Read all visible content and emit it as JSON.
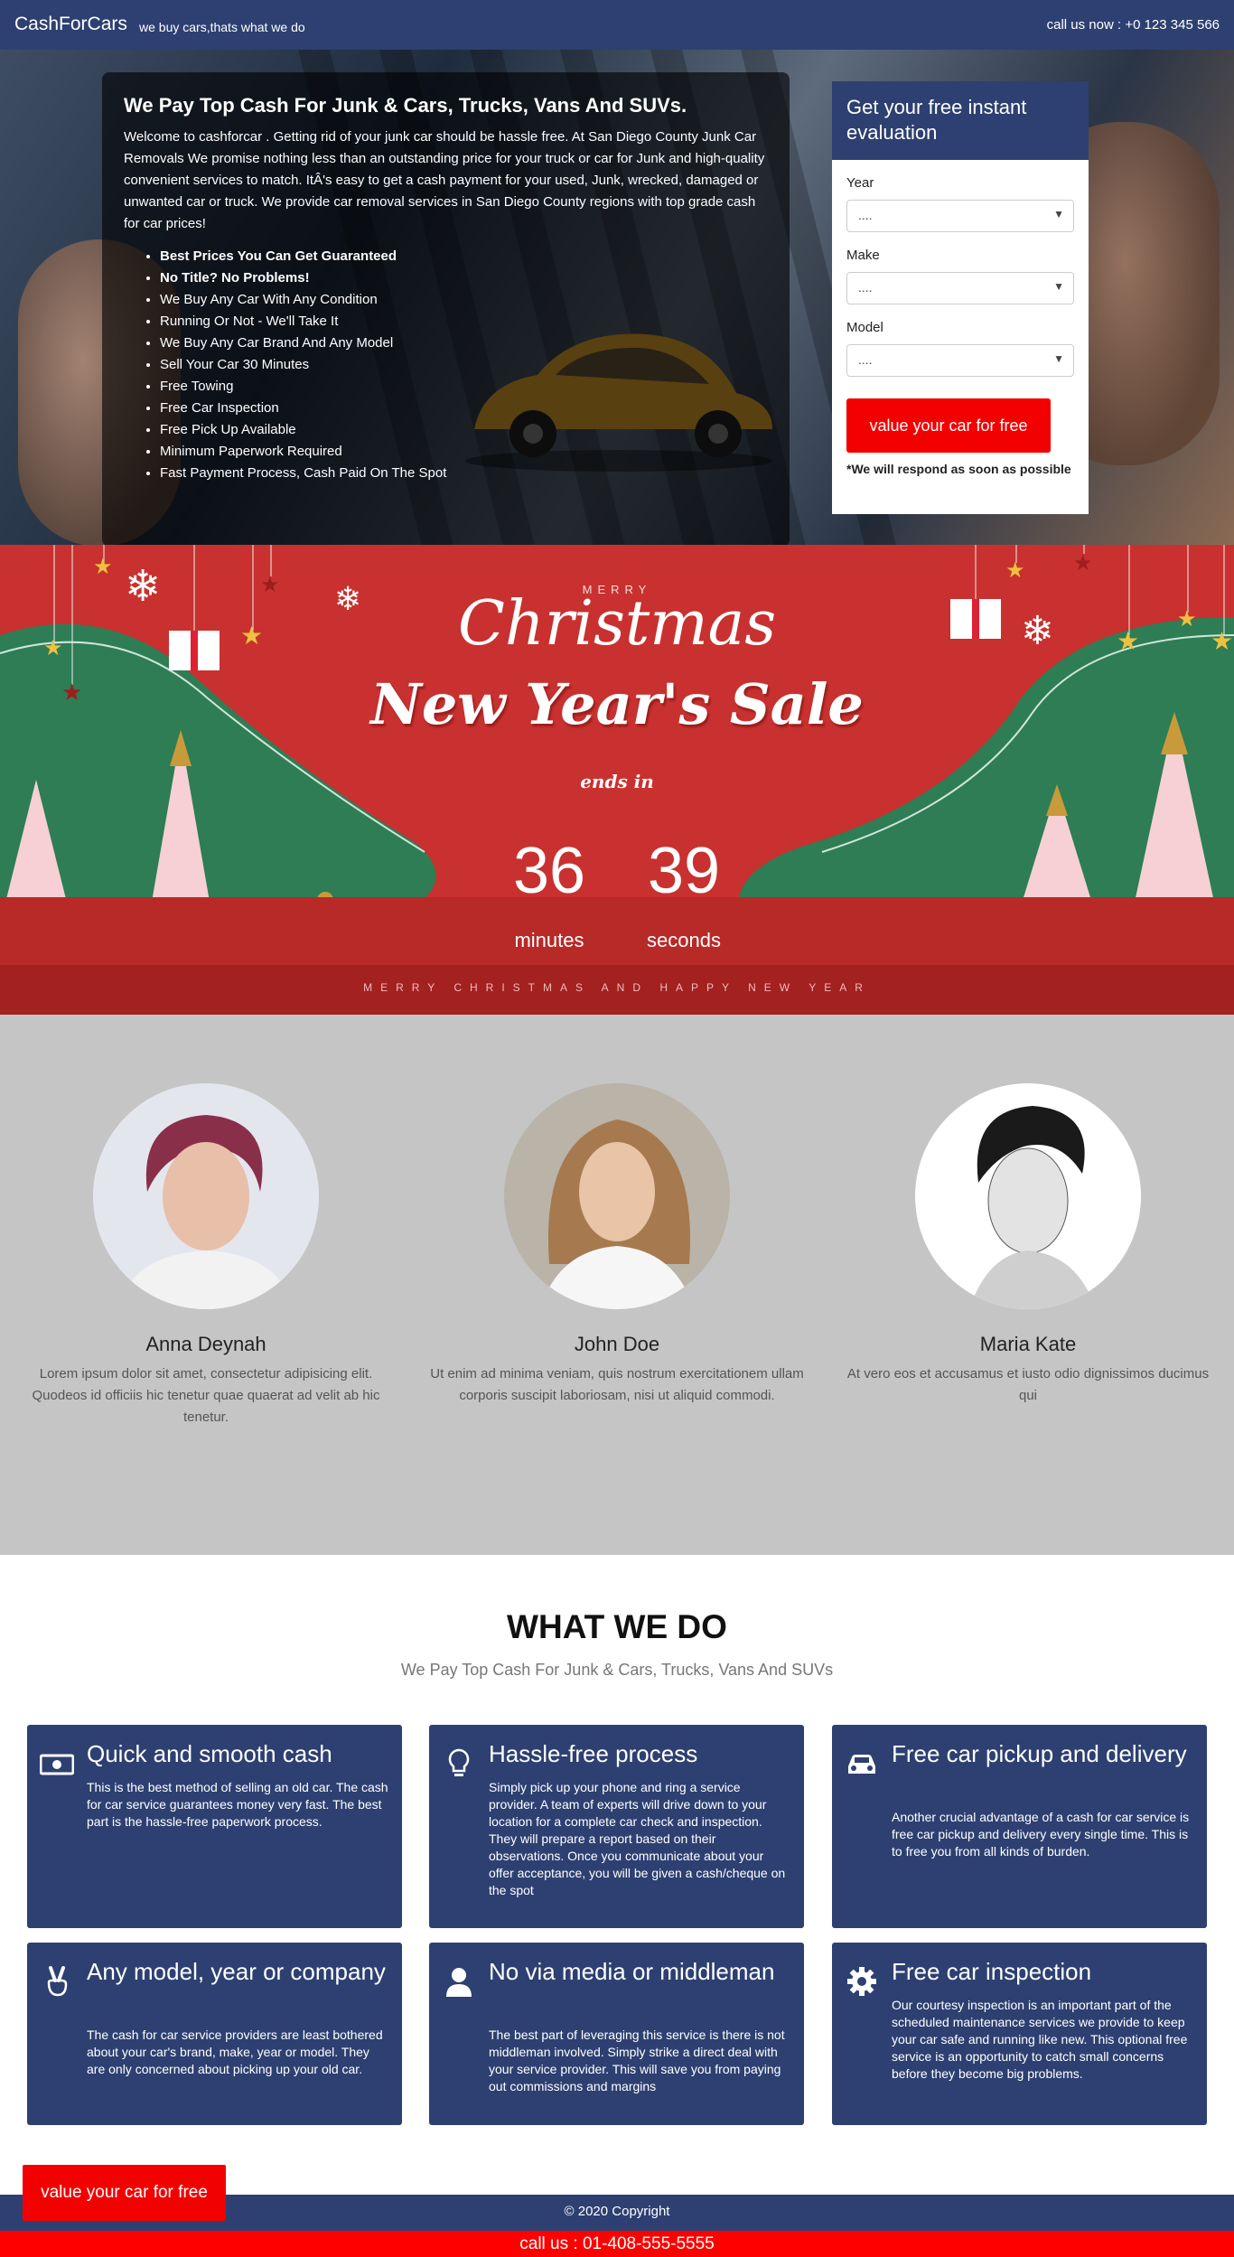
{
  "header": {
    "brand": "CashForCars",
    "tagline": "we buy cars,thats what we do",
    "call_now": "call us now : +0 123 345 566"
  },
  "hero": {
    "title": "We Pay Top Cash For Junk & Cars, Trucks, Vans And SUVs.",
    "intro": "Welcome to cashforcar . Getting rid of your junk car should be hassle free. At San Diego County Junk Car Removals We promise nothing less than an outstanding price for your truck or car for Junk and high-quality convenient services to match. ItÂ's easy to get a cash payment for your used, Junk, wrecked, damaged or unwanted car or truck. We provide car removal services in San Diego County regions with top grade cash for car prices!",
    "bullets": [
      "Best Prices You Can Get Guaranteed",
      "No Title? No Problems!",
      "We Buy Any Car With Any Condition",
      "Running Or Not - We'll Take It",
      "We Buy Any Car Brand And Any Model",
      "Sell Your Car 30 Minutes",
      "Free Towing",
      "Free Car Inspection",
      "Free Pick Up Available",
      "Minimum Paperwork Required",
      "Fast Payment Process, Cash Paid On The Spot"
    ]
  },
  "form": {
    "title": "Get your free instant evaluation",
    "year_label": "Year",
    "year_value": "....",
    "make_label": "Make",
    "make_value": "....",
    "model_label": "Model",
    "model_value": "....",
    "submit_label": "value your car for free",
    "note": "*We will respond as soon as possible"
  },
  "promo": {
    "merry": "MERRY",
    "christmas": "Christmas",
    "sale": "New Year's Sale",
    "ends_in": "ends in",
    "minutes_value": "36",
    "minutes_label": "minutes",
    "seconds_value": "39",
    "seconds_label": "seconds",
    "footer": "MERRY CHRISTMAS AND HAPPY NEW YEAR"
  },
  "team": [
    {
      "name": "Anna Deynah",
      "text": "Lorem ipsum dolor sit amet, consectetur adipisicing elit. Quodeos id officiis hic tenetur quae quaerat ad velit ab hic tenetur."
    },
    {
      "name": "John Doe",
      "text": "Ut enim ad minima veniam, quis nostrum exercitationem ullam corporis suscipit laboriosam, nisi ut aliquid commodi."
    },
    {
      "name": "Maria Kate",
      "text": "At vero eos et accusamus et iusto odio dignissimos ducimus qui"
    }
  ],
  "services": {
    "title": "WHAT WE DO",
    "subtitle": "We Pay Top Cash For Junk & Cars, Trucks, Vans And SUVs",
    "items": [
      {
        "icon": "money-icon",
        "title": "Quick and smooth cash",
        "text": "This is the best method of selling an old car. The cash for car service guarantees money very fast. The best part is the hassle-free paperwork process."
      },
      {
        "icon": "lightbulb-icon",
        "title": "Hassle-free process",
        "text": "Simply pick up your phone and ring a service provider. A team of experts will drive down to your location for a complete car check and inspection. They will prepare a report based on their observations. Once you communicate about your offer acceptance, you will be given a cash/cheque on the spot"
      },
      {
        "icon": "car-icon",
        "title": "Free car pickup and delivery",
        "text": "Another crucial advantage of a cash for car service is free car pickup and delivery every single time. This is to free you from all kinds of burden."
      },
      {
        "icon": "victory-hand-icon",
        "title": "Any model, year or company",
        "text": "The cash for car service providers are least bothered about your car's brand, make, year or model. They are only concerned about picking up your old car."
      },
      {
        "icon": "user-icon",
        "title": "No via media or middleman",
        "text": "The best part of leveraging this service is there is not middleman involved. Simply strike a direct deal with your service provider. This will save you from paying out commissions and margins"
      },
      {
        "icon": "gear-icon",
        "title": "Free car inspection",
        "text": "Our courtesy inspection is an important part of the scheduled maintenance services we provide to keep your car safe and running like new. This optional free service is an opportunity to catch small concerns before they become big problems."
      }
    ]
  },
  "footer": {
    "cta": "value your car for free",
    "copyright": "© 2020 Copyright",
    "call": "call us : 01-408-555-5555"
  },
  "colors": {
    "navy": "#2d4071",
    "red": "#f30000",
    "promo_red": "#c8312f",
    "promo_green": "#2e7d55",
    "team_bg": "#c5c5c5"
  }
}
